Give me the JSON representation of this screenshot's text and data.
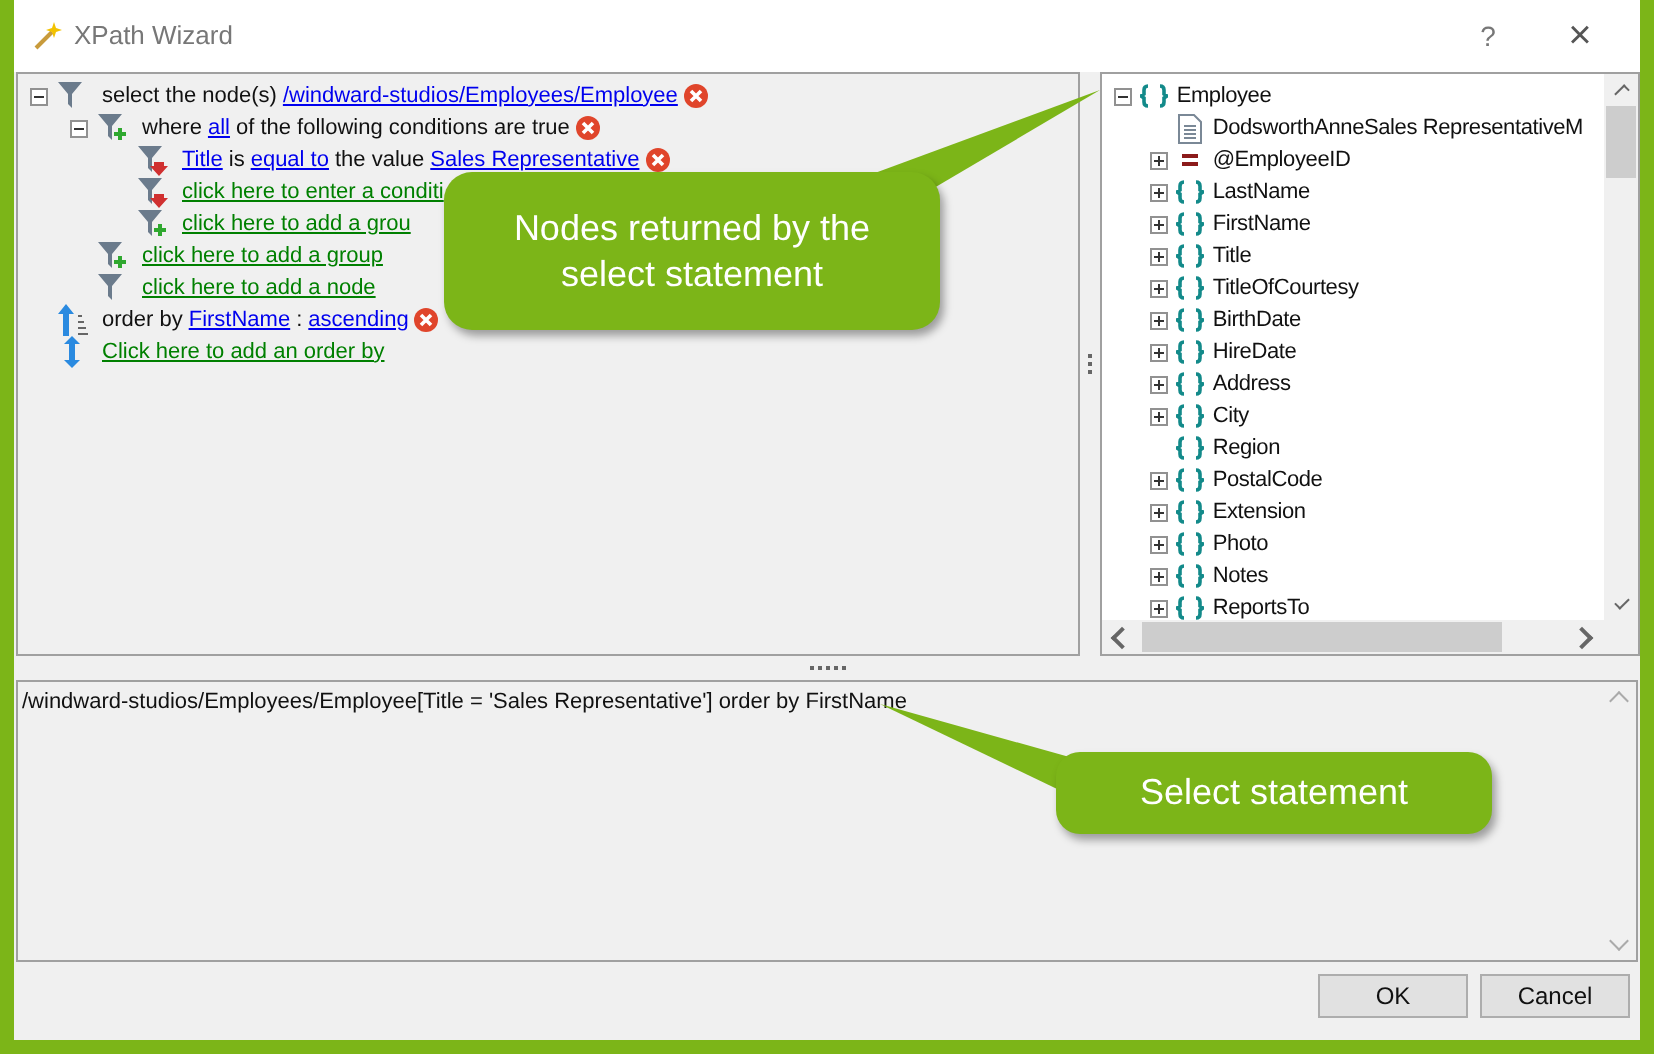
{
  "window": {
    "title": "XPath Wizard",
    "help": "?",
    "close": "×"
  },
  "query_tree": [
    {
      "kind": "select",
      "expanded": true,
      "removable": true,
      "segments": [
        {
          "kind": "text",
          "text": "select the node(s)"
        },
        {
          "kind": "link",
          "text": "/windward-studios/Employees/Employee"
        }
      ],
      "children": [
        {
          "kind": "group",
          "expanded": true,
          "removable": true,
          "segments": [
            {
              "kind": "text",
              "text": "where"
            },
            {
              "kind": "link",
              "text": "all"
            },
            {
              "kind": "text",
              "text": "of the following conditions are true"
            }
          ],
          "children": [
            {
              "kind": "condition",
              "removable": true,
              "segments": [
                {
                  "kind": "link",
                  "text": "Title"
                },
                {
                  "kind": "text",
                  "text": "is"
                },
                {
                  "kind": "link",
                  "text": "equal to"
                },
                {
                  "kind": "text",
                  "text": "the value"
                },
                {
                  "kind": "link",
                  "text": "Sales Representative"
                }
              ]
            },
            {
              "kind": "condition",
              "segments": [
                {
                  "kind": "action",
                  "text": "click here to enter a conditi"
                }
              ]
            },
            {
              "kind": "group",
              "segments": [
                {
                  "kind": "action",
                  "text": "click here to add a grou"
                }
              ]
            }
          ]
        },
        {
          "kind": "group",
          "removable": false,
          "segments": [
            {
              "kind": "action",
              "text": "click here to add a group"
            }
          ]
        },
        {
          "kind": "select",
          "removable": false,
          "segments": [
            {
              "kind": "action",
              "text": "click here to add a node"
            }
          ]
        }
      ]
    },
    {
      "kind": "order",
      "removable": true,
      "segments": [
        {
          "kind": "text",
          "text": "order by"
        },
        {
          "kind": "link",
          "text": "FirstName"
        },
        {
          "kind": "text",
          "text": ":"
        },
        {
          "kind": "link",
          "text": "ascending"
        }
      ]
    },
    {
      "kind": "add-order",
      "removable": false,
      "segments": [
        {
          "kind": "action",
          "text": "Click here to add an order by"
        }
      ]
    }
  ],
  "node_tree": [
    {
      "kind": "element",
      "label": "Employee",
      "expanded": true,
      "children": [
        {
          "kind": "text",
          "label": "DodsworthAnneSales RepresentativeM"
        },
        {
          "kind": "attribute",
          "label": "@EmployeeID",
          "expanded": false
        },
        {
          "kind": "element",
          "label": "LastName",
          "expanded": false
        },
        {
          "kind": "element",
          "label": "FirstName",
          "expanded": false
        },
        {
          "kind": "element",
          "label": "Title",
          "expanded": false
        },
        {
          "kind": "element",
          "label": "TitleOfCourtesy",
          "expanded": false
        },
        {
          "kind": "element",
          "label": "BirthDate",
          "expanded": false
        },
        {
          "kind": "element",
          "label": "HireDate",
          "expanded": false
        },
        {
          "kind": "element",
          "label": "Address",
          "expanded": false
        },
        {
          "kind": "element",
          "label": "City",
          "expanded": false
        },
        {
          "kind": "element",
          "label": "Region"
        },
        {
          "kind": "element",
          "label": "PostalCode",
          "expanded": false
        },
        {
          "kind": "element",
          "label": "Extension",
          "expanded": false
        },
        {
          "kind": "element",
          "label": "Photo",
          "expanded": false
        },
        {
          "kind": "element",
          "label": "Notes",
          "expanded": false
        },
        {
          "kind": "element",
          "label": "ReportsTo",
          "expanded": false
        }
      ]
    }
  ],
  "statement": "/windward-studios/Employees/Employee[Title = 'Sales Representative'] order by FirstName",
  "buttons": [
    "OK",
    "Cancel"
  ],
  "callouts": [
    {
      "text": "Nodes returned by the select statement"
    },
    {
      "text": "Select statement"
    }
  ]
}
